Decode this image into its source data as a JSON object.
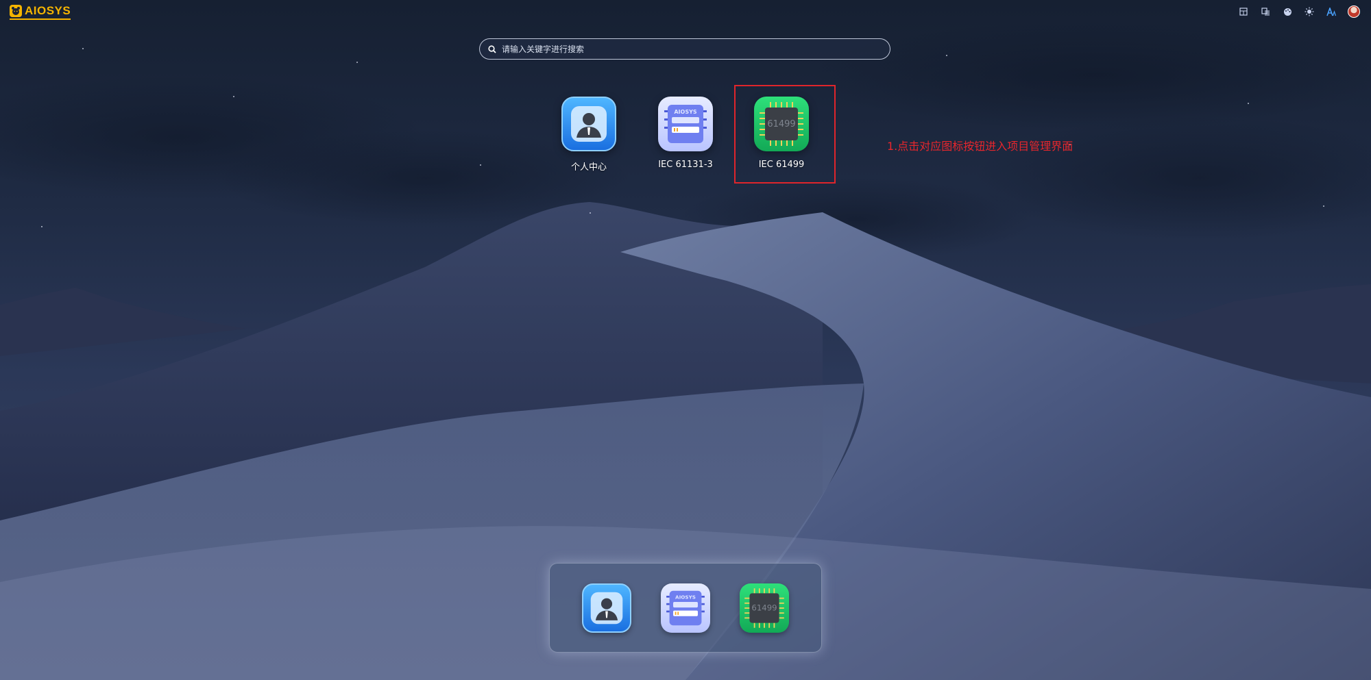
{
  "logo": {
    "text": "AIOSYS"
  },
  "search": {
    "placeholder": "请输入关键字进行搜索",
    "value": ""
  },
  "apps": [
    {
      "label": "个人中心",
      "icon": "user-center-icon"
    },
    {
      "label": "IEC 61131-3",
      "icon": "iec61131-chip-icon",
      "badge": "AIOSYS"
    },
    {
      "label": "IEC 61499",
      "icon": "iec61499-chip-icon",
      "badge": "61499"
    }
  ],
  "annotation": {
    "text": "1.点击对应图标按钮进入项目管理界面",
    "color": "#e8262c"
  },
  "toolbar": {
    "items": [
      "layout-icon",
      "translate-icon",
      "palette-icon",
      "sun-icon",
      "font-size-icon",
      "avatar"
    ]
  },
  "dock": {
    "items": [
      {
        "icon": "user-center-icon"
      },
      {
        "icon": "iec61131-chip-icon",
        "badge": "AIOSYS"
      },
      {
        "icon": "iec61499-chip-icon",
        "badge": "61499"
      }
    ]
  },
  "colors": {
    "logo": "#f5b400",
    "highlight_border": "#e0252b",
    "user_icon": "#1a6fe0",
    "iec61131_icon": "#b9c4ff",
    "iec61499_icon": "#12a956"
  }
}
